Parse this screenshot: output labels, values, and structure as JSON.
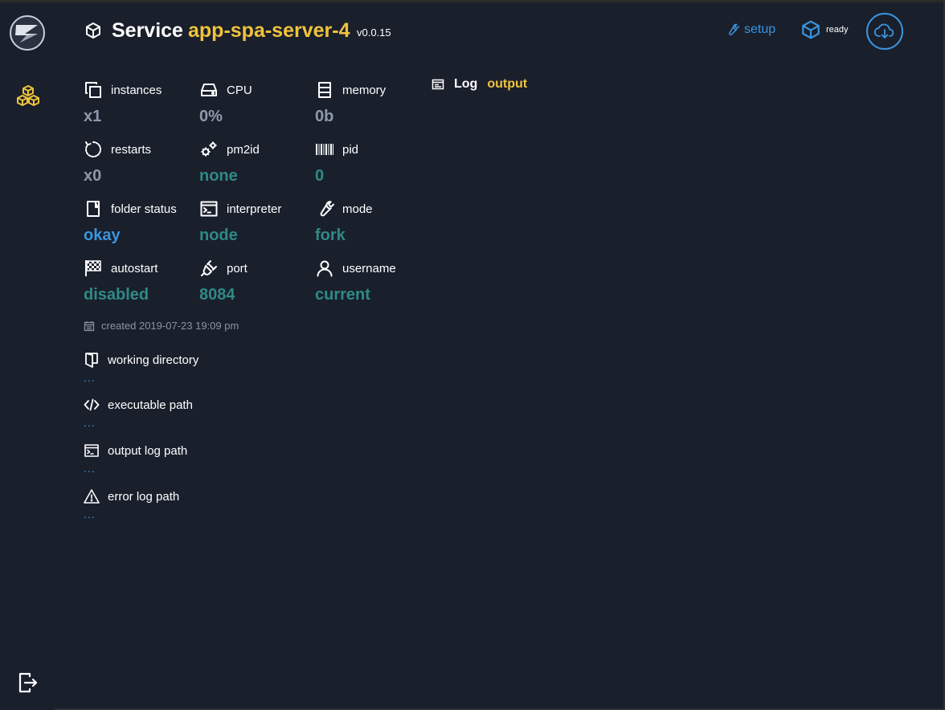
{
  "colors": {
    "background": "#1a1f2c",
    "accent": "#3a95df",
    "highlight": "#f0c33c",
    "teal": "#2f8a86",
    "muted": "#8e9aab"
  },
  "sidebar": {
    "logo_icon": "app-logo",
    "items": [
      {
        "icon": "cubes-icon",
        "active": true
      },
      {
        "icon": "exit-icon",
        "active": false
      }
    ]
  },
  "header": {
    "title": "Service",
    "service_name": "app-spa-server-4",
    "version": "v0.0.15",
    "setup_label": "setup",
    "status_label": "ready"
  },
  "stats": {
    "instances": {
      "label": "instances",
      "value": "x1"
    },
    "cpu": {
      "label": "CPU",
      "value": "0%"
    },
    "memory": {
      "label": "memory",
      "value": "0b"
    },
    "restarts": {
      "label": "restarts",
      "value": "x0"
    },
    "pm2id": {
      "label": "pm2id",
      "value": "none"
    },
    "pid": {
      "label": "pid",
      "value": "0"
    },
    "folder_status": {
      "label": "folder status",
      "value": "okay"
    },
    "interpreter": {
      "label": "interpreter",
      "value": "node"
    },
    "mode": {
      "label": "mode",
      "value": "fork"
    },
    "autostart": {
      "label": "autostart",
      "value": "disabled"
    },
    "port": {
      "label": "port",
      "value": "8084"
    },
    "username": {
      "label": "username",
      "value": "current"
    }
  },
  "created": "created 2019-07-23 19:09 pm",
  "paths": {
    "working_directory": {
      "label": "working directory",
      "value": "..."
    },
    "executable_path": {
      "label": "executable path",
      "value": "..."
    },
    "output_log_path": {
      "label": "output log path",
      "value": "..."
    },
    "error_log_path": {
      "label": "error log path",
      "value": "..."
    }
  },
  "log": {
    "title": "Log",
    "selected": "output"
  }
}
